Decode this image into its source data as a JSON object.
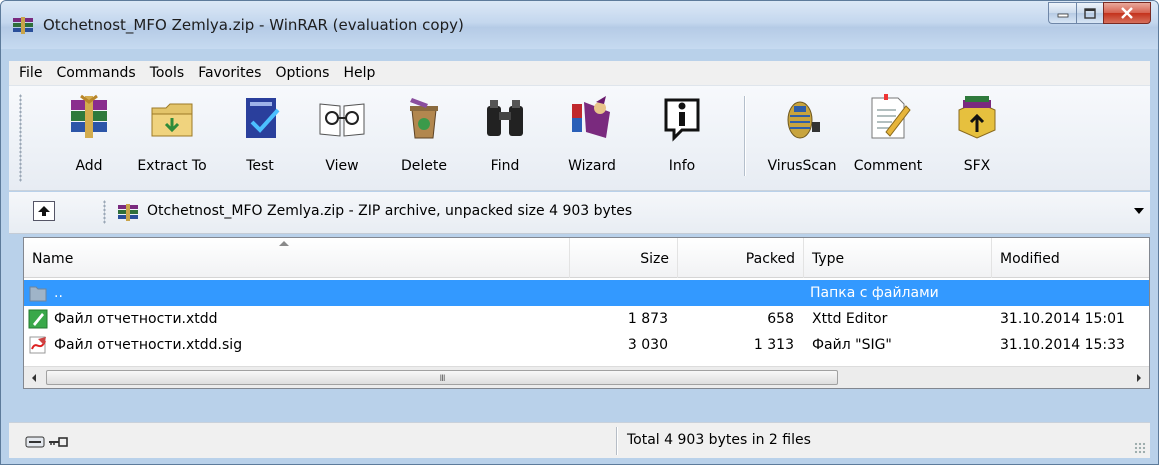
{
  "window": {
    "title": "Otchetnost_MFO Zemlya.zip - WinRAR (evaluation copy)",
    "app_icon": "winrar-icon"
  },
  "menu": [
    {
      "label": "File",
      "name": "menu-file"
    },
    {
      "label": "Commands",
      "name": "menu-commands"
    },
    {
      "label": "Tools",
      "name": "menu-tools"
    },
    {
      "label": "Favorites",
      "name": "menu-favorites"
    },
    {
      "label": "Options",
      "name": "menu-options"
    },
    {
      "label": "Help",
      "name": "menu-help"
    }
  ],
  "toolbar": {
    "add": "Add",
    "extract_to": "Extract To",
    "test": "Test",
    "view": "View",
    "delete": "Delete",
    "find": "Find",
    "wizard": "Wizard",
    "info": "Info",
    "virusscan": "VirusScan",
    "comment": "Comment",
    "sfx": "SFX"
  },
  "address": {
    "text": "Otchetnost_MFO Zemlya.zip - ZIP archive, unpacked size 4 903 bytes"
  },
  "columns": {
    "name": "Name",
    "size": "Size",
    "packed": "Packed",
    "type": "Type",
    "modified": "Modified"
  },
  "rows": [
    {
      "name": "..",
      "size": "",
      "packed": "",
      "type": "Папка с файлами",
      "modified": "",
      "icon": "folder-up-icon",
      "selected": true
    },
    {
      "name": "Файл отчетности.xtdd",
      "size": "1 873",
      "packed": "658",
      "type": "Xttd Editor",
      "modified": "31.10.2014 15:01",
      "icon": "xtdd-file-icon",
      "selected": false
    },
    {
      "name": "Файл отчетности.xtdd.sig",
      "size": "3 030",
      "packed": "1 313",
      "type": "Файл \"SIG\"",
      "modified": "31.10.2014 15:33",
      "icon": "sig-file-icon",
      "selected": false
    }
  ],
  "scrollbar": {
    "grip": "III"
  },
  "status": {
    "text": "Total 4 903 bytes in 2 files"
  },
  "colors": {
    "selection": "#3399ff",
    "frame": "#b9d1ea",
    "close_button": "#c4321c"
  }
}
